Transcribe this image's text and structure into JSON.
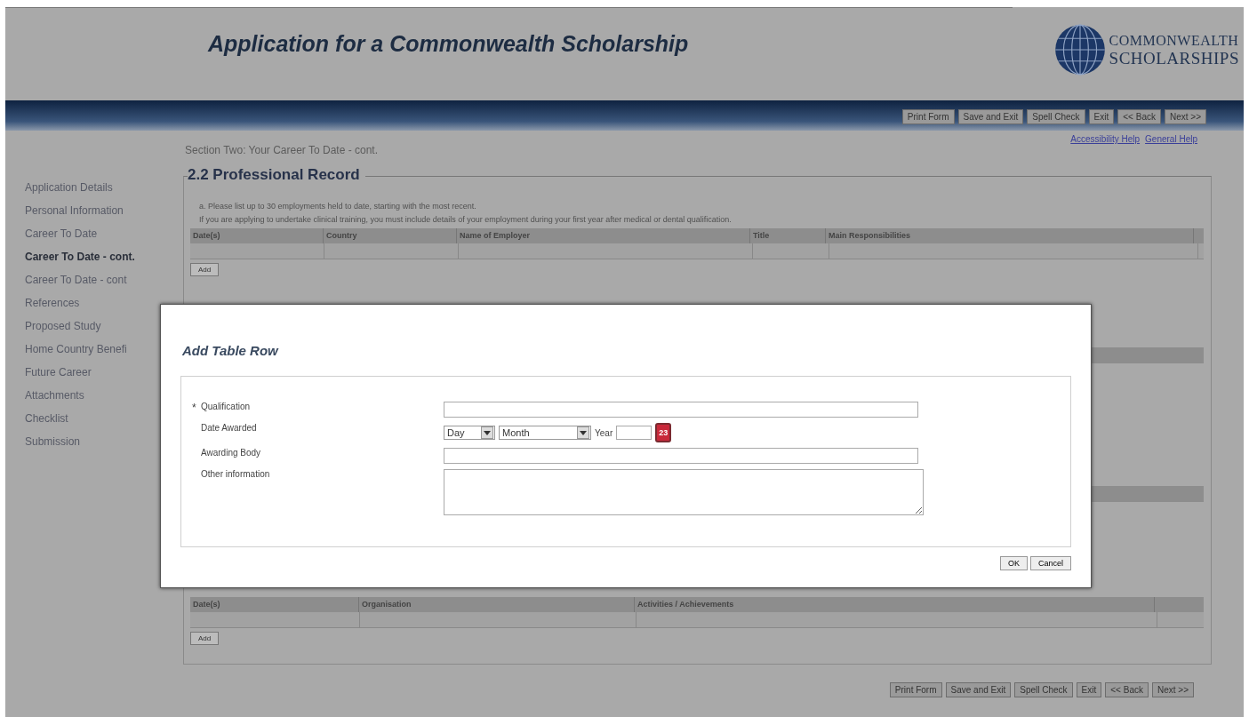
{
  "header": {
    "title": "Application for a Commonwealth Scholarship",
    "logo_lines": [
      "COMMONWEALTH",
      "SCHOLARSHIPS"
    ]
  },
  "toolbar": [
    {
      "label": "Print Form"
    },
    {
      "label": "Save and Exit"
    },
    {
      "label": "Spell Check"
    },
    {
      "label": "Exit"
    },
    {
      "label": "<< Back"
    },
    {
      "label": "Next >>"
    }
  ],
  "help_links": [
    "Accessibility Help",
    "General Help"
  ],
  "section_heading": "Section Two: Your Career To Date - cont.",
  "sidebar": {
    "items": [
      {
        "label": "Application Details",
        "selected": false
      },
      {
        "label": "Personal Information",
        "selected": false
      },
      {
        "label": "Career To Date",
        "selected": false
      },
      {
        "label": "Career To Date - cont.",
        "selected": true
      },
      {
        "label": "Career To Date - cont",
        "selected": false
      },
      {
        "label": "References",
        "selected": false
      },
      {
        "label": "Proposed Study",
        "selected": false
      },
      {
        "label": "Home Country Benefi",
        "selected": false
      },
      {
        "label": "Future Career",
        "selected": false
      },
      {
        "label": "Attachments",
        "selected": false
      },
      {
        "label": "Checklist",
        "selected": false
      },
      {
        "label": "Submission",
        "selected": false
      }
    ]
  },
  "panel": {
    "legend": "2.2 Professional Record",
    "instructions": [
      "a. Please list up to 30 employments held to date, starting with the most recent.",
      "If you are applying to undertake clinical training, you must include details of your employment during your first year after medical or dental qualification."
    ],
    "employment_table": {
      "columns": [
        "Date(s)",
        "Country",
        "Name of Employer",
        "Title",
        "Main Responsibilities"
      ]
    },
    "add_button": "Add",
    "activities_table": {
      "columns": [
        "Date(s)",
        "Organisation",
        "Activities / Achievements"
      ]
    },
    "activities_add_button": "Add"
  },
  "bottom_toolbar": [
    {
      "label": "Print Form"
    },
    {
      "label": "Save and Exit"
    },
    {
      "label": "Spell Check"
    },
    {
      "label": "Exit"
    },
    {
      "label": "<< Back"
    },
    {
      "label": "Next >>"
    }
  ],
  "dialog": {
    "title": "Add Table Row",
    "fields": [
      {
        "kind": "text",
        "label": "Qualification",
        "required": true
      },
      {
        "kind": "date",
        "label": "Date Awarded",
        "required": false,
        "day": "Day",
        "month": "Month",
        "year_label": "Year",
        "calendar_day": "23"
      },
      {
        "kind": "text",
        "label": "Awarding Body",
        "required": false
      },
      {
        "kind": "textarea",
        "label": "Other information",
        "required": false
      }
    ],
    "required_mark": "*",
    "buttons": [
      "OK",
      "Cancel"
    ]
  }
}
